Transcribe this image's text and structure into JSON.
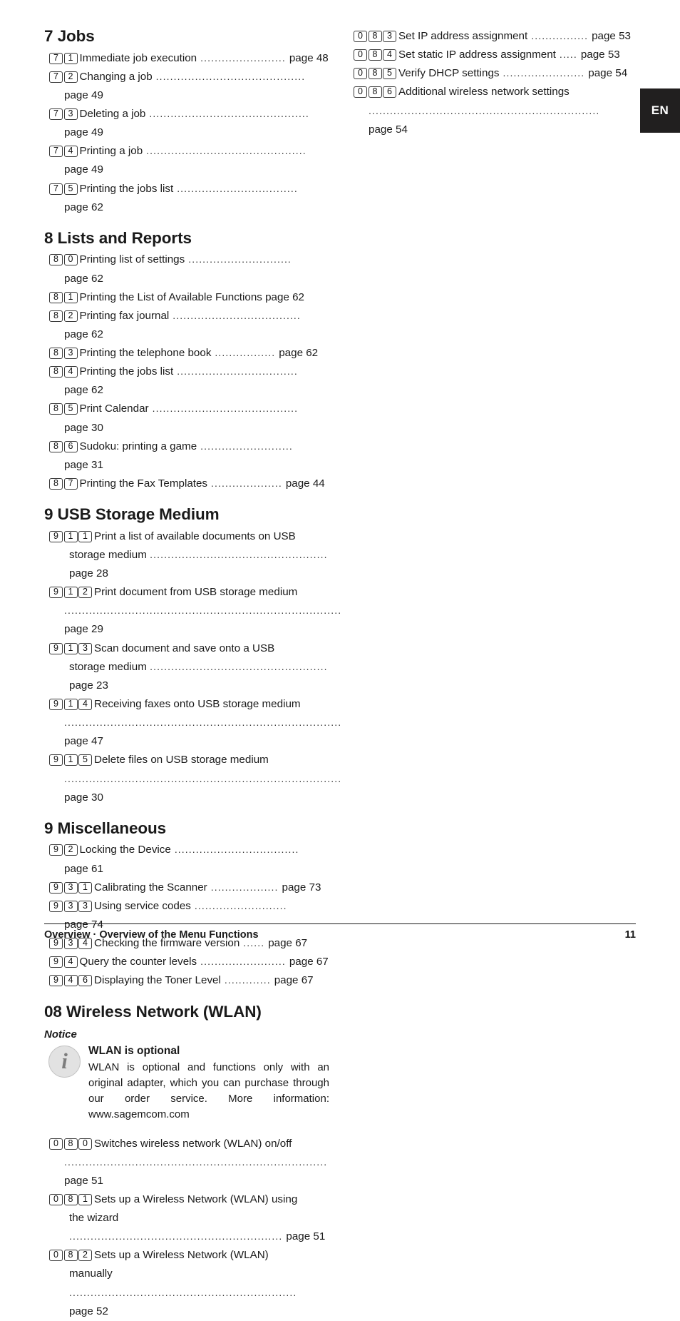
{
  "lang_tab": "EN",
  "footer": {
    "text": "Overview · Overview of the Menu Functions",
    "page_number": "11"
  },
  "left_column": {
    "sections": [
      {
        "heading": "7 Jobs",
        "entries": [
          {
            "keys": [
              "7",
              "1"
            ],
            "title": "Immediate job execution",
            "leader": "........................",
            "page": "page 48"
          },
          {
            "keys": [
              "7",
              "2"
            ],
            "title": "Changing a job",
            "leader": "..........................................",
            "page": "page 49"
          },
          {
            "keys": [
              "7",
              "3"
            ],
            "title": "Deleting a job",
            "leader": ".............................................",
            "page": "page 49"
          },
          {
            "keys": [
              "7",
              "4"
            ],
            "title": "Printing a job",
            "leader": ".............................................",
            "page": "page 49"
          },
          {
            "keys": [
              "7",
              "5"
            ],
            "title": "Printing the jobs list",
            "leader": "..................................",
            "page": "page 62"
          }
        ]
      },
      {
        "heading": "8 Lists and Reports",
        "entries": [
          {
            "keys": [
              "8",
              "0"
            ],
            "title": "Printing list of settings",
            "leader": ".............................",
            "page": "page 62"
          },
          {
            "keys": [
              "8",
              "1"
            ],
            "title": "Printing the List of Available Functions",
            "leader": "",
            "page": "page 62"
          },
          {
            "keys": [
              "8",
              "2"
            ],
            "title": "Printing fax journal",
            "leader": "....................................",
            "page": "page 62"
          },
          {
            "keys": [
              "8",
              "3"
            ],
            "title": "Printing the telephone book",
            "leader": ".................",
            "page": "page 62"
          },
          {
            "keys": [
              "8",
              "4"
            ],
            "title": "Printing the jobs list",
            "leader": "..................................",
            "page": "page 62"
          },
          {
            "keys": [
              "8",
              "5"
            ],
            "title": "Print Calendar",
            "leader": ".........................................",
            "page": "page 30"
          },
          {
            "keys": [
              "8",
              "6"
            ],
            "title": "Sudoku: printing a game",
            "leader": "..........................",
            "page": "page 31"
          },
          {
            "keys": [
              "8",
              "7"
            ],
            "title": "Printing the Fax Templates",
            "leader": "....................",
            "page": "page 44"
          }
        ]
      },
      {
        "heading": "9 USB Storage Medium",
        "entries": [
          {
            "keys": [
              "9",
              "1",
              "1"
            ],
            "title": "Print a list of available documents on USB",
            "wrap_text": "storage medium",
            "leader": "..................................................",
            "page": "page 28"
          },
          {
            "keys": [
              "9",
              "1",
              "2"
            ],
            "title": "Print document from USB storage medium",
            "wrap_text": "",
            "leader": "..............................................................................",
            "page": "page 29"
          },
          {
            "keys": [
              "9",
              "1",
              "3"
            ],
            "title": "Scan document and save onto a USB",
            "wrap_text": "storage medium",
            "leader": "..................................................",
            "page": "page 23"
          },
          {
            "keys": [
              "9",
              "1",
              "4"
            ],
            "title": "Receiving faxes onto USB storage medium",
            "wrap_text": "",
            "leader": "..............................................................................",
            "page": "page 47"
          },
          {
            "keys": [
              "9",
              "1",
              "5"
            ],
            "title": "Delete files on USB storage medium",
            "wrap_text": "",
            "leader": "..............................................................................",
            "page": "page 30"
          }
        ]
      },
      {
        "heading": "9 Miscellaneous",
        "entries": [
          {
            "keys": [
              "9",
              "2"
            ],
            "title": "Locking the Device",
            "leader": "...................................",
            "page": "page 61"
          },
          {
            "keys": [
              "9",
              "3",
              "1"
            ],
            "title": "Calibrating the Scanner",
            "leader": "...................",
            "page": "page 73"
          },
          {
            "keys": [
              "9",
              "3",
              "3"
            ],
            "title": "Using service codes",
            "leader": "..........................",
            "page": "page 74"
          },
          {
            "keys": [
              "9",
              "3",
              "4"
            ],
            "title": "Checking the firmware version",
            "leader": "......",
            "page": "page 67"
          },
          {
            "keys": [
              "9",
              "4"
            ],
            "title": "Query the counter levels",
            "leader": "........................",
            "page": "page 67"
          },
          {
            "keys": [
              "9",
              "4",
              "6"
            ],
            "title": "Displaying the Toner Level",
            "leader": ".............",
            "page": "page 67"
          }
        ]
      }
    ],
    "wlan_section": {
      "heading": "08 Wireless Network (WLAN)",
      "notice_label": "Notice",
      "notice_icon": "info-icon",
      "notice_title": "WLAN is optional",
      "notice_text": "WLAN is optional and functions only with an original adapter, which you can purchase through our order service. More information: www.sagemcom.com",
      "entries": [
        {
          "keys": [
            "0",
            "8",
            "0"
          ],
          "title": "Switches wireless network (WLAN) on/off",
          "wrap_text": "",
          "leader": "..........................................................................",
          "page": "page 51"
        },
        {
          "keys": [
            "0",
            "8",
            "1"
          ],
          "title": "Sets up a Wireless Network (WLAN) using",
          "wrap_text": "the wizard",
          "leader": "............................................................",
          "page": "page 51"
        },
        {
          "keys": [
            "0",
            "8",
            "2"
          ],
          "title": "Sets up a Wireless Network (WLAN)",
          "wrap_text": "manually",
          "leader": "................................................................",
          "page": "page 52"
        }
      ]
    }
  },
  "right_column": {
    "entries": [
      {
        "keys": [
          "0",
          "8",
          "3"
        ],
        "title": "Set IP address assignment",
        "wrap_text": null,
        "leader": "................",
        "page": "page 53"
      },
      {
        "keys": [
          "0",
          "8",
          "4"
        ],
        "title": "Set static IP address assignment",
        "wrap_text": null,
        "leader": ".....",
        "page": "page 53"
      },
      {
        "keys": [
          "0",
          "8",
          "5"
        ],
        "title": "Verify DHCP settings",
        "wrap_text": null,
        "leader": ".......................",
        "page": "page 54"
      },
      {
        "keys": [
          "0",
          "8",
          "6"
        ],
        "title": "Additional wireless network settings",
        "wrap_text": "",
        "leader": ".................................................................",
        "page": "page 54"
      }
    ]
  }
}
